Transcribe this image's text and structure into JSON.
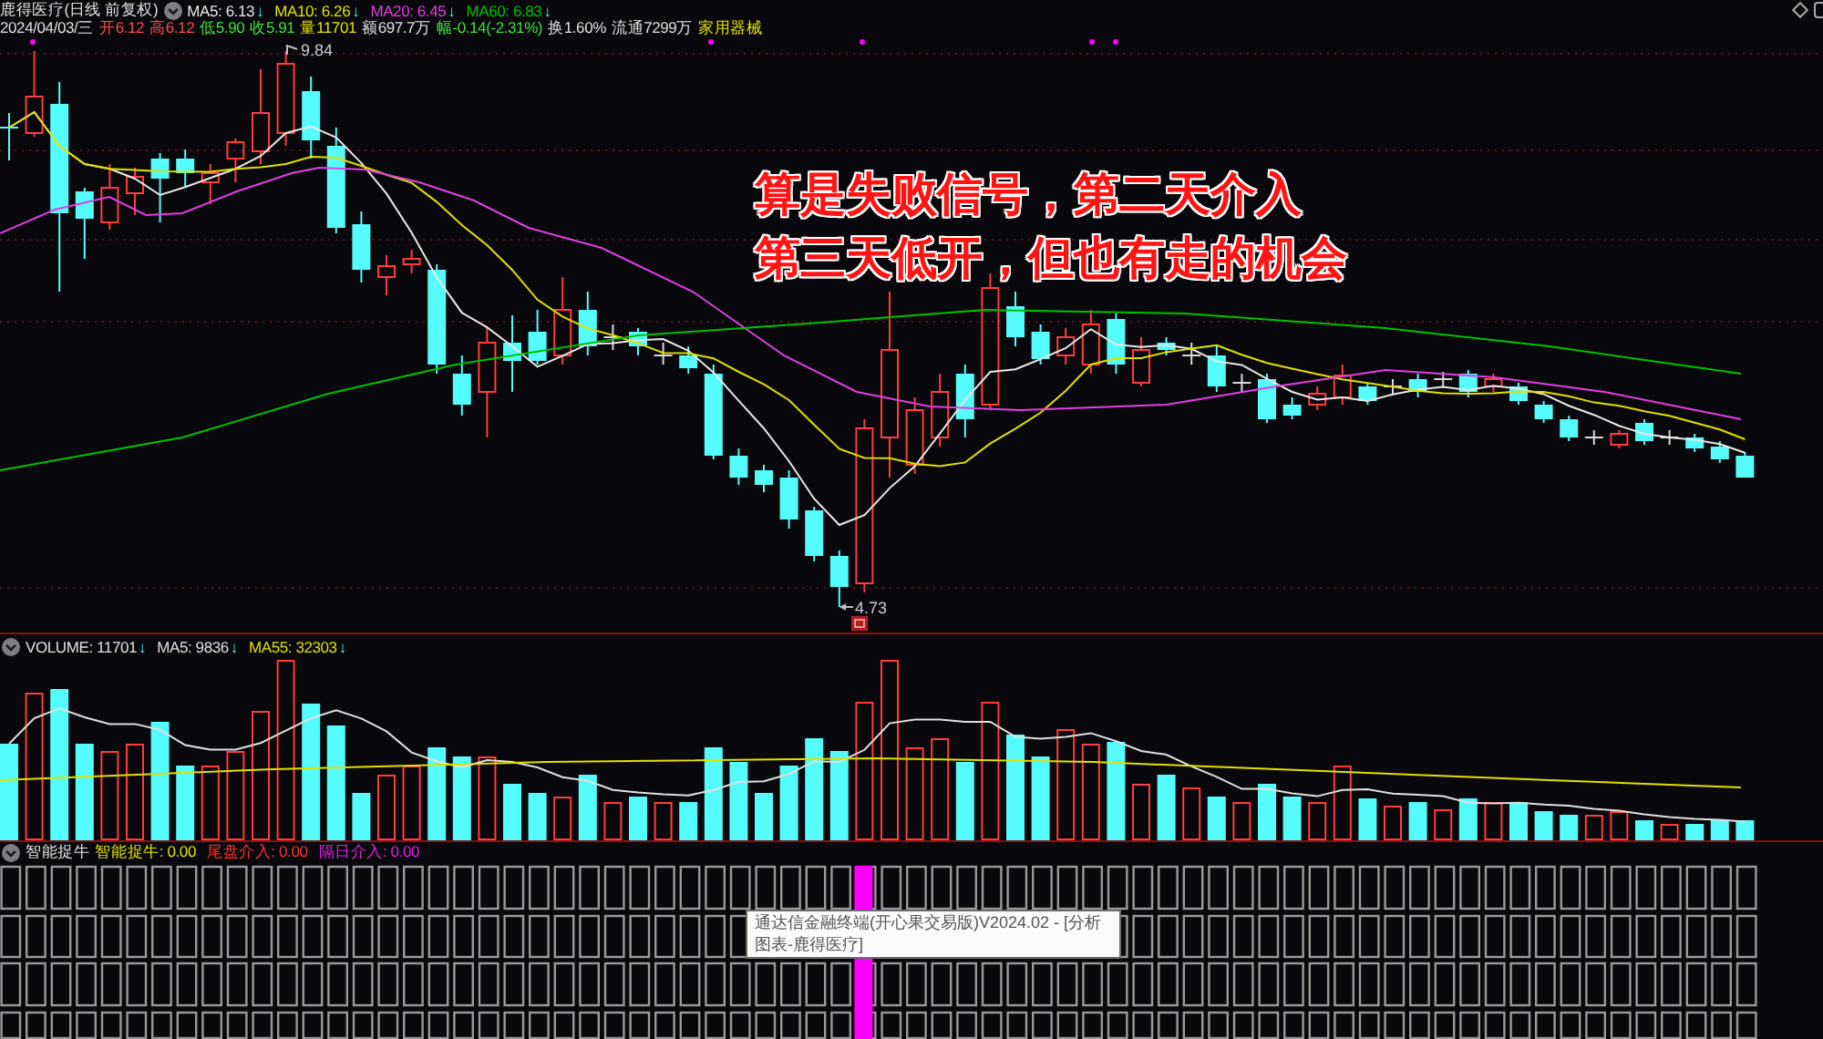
{
  "chart": {
    "title": "鹿得医疗(日线 前复权)",
    "indicators": [
      {
        "label": "MA5: 6.13",
        "arrow": "↓",
        "color": "#e8e8e8"
      },
      {
        "label": "MA10: 6.26",
        "arrow": "↓",
        "color": "#e0e000"
      },
      {
        "label": "MA20: 6.45",
        "arrow": "↓",
        "color": "#e040e0"
      },
      {
        "label": "MA60: 6.83",
        "arrow": "↓",
        "color": "#00c000"
      }
    ],
    "quote": [
      {
        "text": "2024/04/03/三",
        "color": "#e0e0e0"
      },
      {
        "text": "开6.12",
        "color": "#ff4d4d"
      },
      {
        "text": "高6.12",
        "color": "#ff4d4d"
      },
      {
        "text": "低5.90",
        "color": "#3ee03e"
      },
      {
        "text": "收5.91",
        "color": "#3ee03e"
      },
      {
        "text": "量11701",
        "color": "#e0e000"
      },
      {
        "text": "额697.7万",
        "color": "#e0e0e0"
      },
      {
        "text": "幅-0.14(-2.31%)",
        "color": "#3ee03e"
      },
      {
        "text": "换1.60%",
        "color": "#e0e0e0"
      },
      {
        "text": "流通7299万",
        "color": "#e0e0e0"
      },
      {
        "text": "家用器械",
        "color": "#e0e000"
      }
    ],
    "high_label": "9.84",
    "low_label": "4.73"
  },
  "annotation": {
    "lines": [
      "算是失败信号，第二天介入",
      "第三天低开，但也有走的机会"
    ]
  },
  "volume": {
    "indicators": [
      {
        "label": "VOLUME: 11701",
        "arrow": "↓",
        "color": "#e0e0e0"
      },
      {
        "label": "MA5: 9836",
        "arrow": "↓",
        "color": "#e0e0e0"
      },
      {
        "label": "MA55: 32303",
        "arrow": "↓",
        "color": "#e0e000"
      }
    ]
  },
  "signal": {
    "name": "智能捉牛",
    "indicators": [
      {
        "label": "智能捉牛: 0.00",
        "color": "#e0e000"
      },
      {
        "label": "尾盘介入: 0.00",
        "color": "#ff3030"
      },
      {
        "label": "隔日介入: 0.00",
        "color": "#e020e0"
      }
    ]
  },
  "tooltip": {
    "text": "通达信金融终端(开心果交易版)V2024.02 - [分析图表-鹿得医疗]"
  }
}
